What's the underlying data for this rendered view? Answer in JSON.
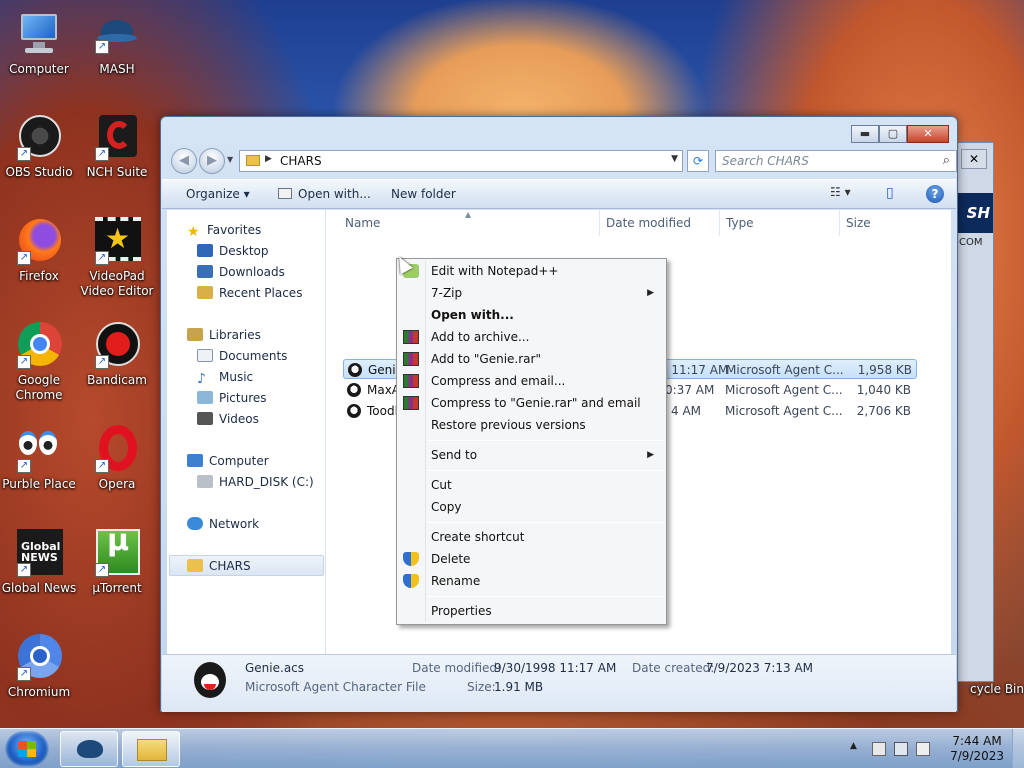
{
  "desktop": {
    "icons": [
      {
        "label": "Computer",
        "name": "computer-icon"
      },
      {
        "label": "MASH",
        "name": "mash-icon"
      },
      {
        "label": "OBS Studio",
        "name": "obs-studio-icon"
      },
      {
        "label": "NCH Suite",
        "name": "nch-suite-icon"
      },
      {
        "label": "Firefox",
        "name": "firefox-icon"
      },
      {
        "label": "VideoPad Video Editor",
        "name": "videopad-icon"
      },
      {
        "label": "Google Chrome",
        "name": "google-chrome-icon"
      },
      {
        "label": "Bandicam",
        "name": "bandicam-icon"
      },
      {
        "label": "Purble Place",
        "name": "purble-place-icon"
      },
      {
        "label": "Opera",
        "name": "opera-icon"
      },
      {
        "label": "Global News",
        "name": "global-news-icon"
      },
      {
        "label": "µTorrent",
        "name": "utorrent-icon"
      },
      {
        "label": "Chromium",
        "name": "chromium-icon"
      },
      {
        "label": "cycle Bin",
        "name": "recycle-bin-icon"
      }
    ],
    "background_window": {
      "logo_text": "SH",
      "text": "COM",
      "close_label": "✕"
    }
  },
  "explorer": {
    "address_path": "CHARS",
    "search_placeholder": "Search CHARS",
    "caption_buttons": {
      "minimize": "▬",
      "maximize": "▢",
      "close": "✕"
    },
    "toolbar": {
      "organize": "Organize ▾",
      "open_with": "Open with...",
      "new_folder": "New folder",
      "view": "☷ ▾",
      "preview": "▯",
      "help": "?"
    },
    "navigation": {
      "favorites": "Favorites",
      "desktop": "Desktop",
      "downloads": "Downloads",
      "recent_places": "Recent Places",
      "libraries": "Libraries",
      "documents": "Documents",
      "music": "Music",
      "pictures": "Pictures",
      "videos": "Videos",
      "computer": "Computer",
      "hard_disk": "HARD_DISK (C:)",
      "network": "Network",
      "chars": "CHARS"
    },
    "columns": {
      "name": "Name",
      "date_modified": "Date modified",
      "type": "Type",
      "size": "Size"
    },
    "files": [
      {
        "name": "Genie.acs",
        "date": "9/30/1998 11:17 AM",
        "type": "Microsoft Agent C...",
        "size": "1,958 KB"
      },
      {
        "name": "MaxA",
        "date": "0:37 AM",
        "type": "Microsoft Agent C...",
        "size": "1,040 KB"
      },
      {
        "name": "Toodl",
        "date": "4 AM",
        "type": "Microsoft Agent C...",
        "size": "2,706 KB"
      }
    ],
    "details": {
      "filename": "Genie.acs",
      "filetype": "Microsoft Agent Character File",
      "modified_label": "Date modified:",
      "modified_value": "9/30/1998 11:17 AM",
      "created_label": "Date created:",
      "created_value": "7/9/2023 7:13 AM",
      "size_label": "Size:",
      "size_value": "1.91 MB"
    }
  },
  "context_menu": {
    "edit_notepad": "Edit with Notepad++",
    "seven_zip": "7-Zip",
    "open_with": "Open with...",
    "add_archive": "Add to archive...",
    "add_rar": "Add to \"Genie.rar\"",
    "compress_email": "Compress and email...",
    "compress_rar_email": "Compress to \"Genie.rar\" and email",
    "restore": "Restore previous versions",
    "send_to": "Send to",
    "cut": "Cut",
    "copy": "Copy",
    "create_shortcut": "Create shortcut",
    "delete": "Delete",
    "rename": "Rename",
    "properties": "Properties"
  },
  "taskbar": {
    "time": "7:44 AM",
    "date": "7/9/2023",
    "tray_arrow": "▲"
  }
}
